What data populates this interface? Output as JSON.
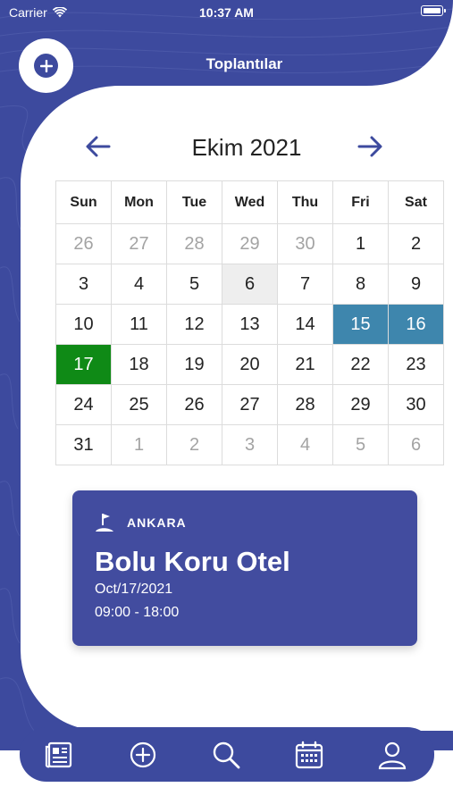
{
  "status": {
    "carrier": "Carrier",
    "time": "10:37 AM"
  },
  "header": {
    "title": "Toplantılar"
  },
  "calendar": {
    "month_label": "Ekim 2021",
    "weekdays": [
      "Sun",
      "Mon",
      "Tue",
      "Wed",
      "Thu",
      "Fri",
      "Sat"
    ],
    "weeks": [
      [
        "26",
        "27",
        "28",
        "29",
        "30",
        "1",
        "2"
      ],
      [
        "3",
        "4",
        "5",
        "6",
        "7",
        "8",
        "9"
      ],
      [
        "10",
        "11",
        "12",
        "13",
        "14",
        "15",
        "16"
      ],
      [
        "17",
        "18",
        "19",
        "20",
        "21",
        "22",
        "23"
      ],
      [
        "24",
        "25",
        "26",
        "27",
        "28",
        "29",
        "30"
      ],
      [
        "31",
        "1",
        "2",
        "3",
        "4",
        "5",
        "6"
      ]
    ],
    "muted": [
      [
        0,
        0
      ],
      [
        0,
        1
      ],
      [
        0,
        2
      ],
      [
        0,
        3
      ],
      [
        0,
        4
      ],
      [
        5,
        1
      ],
      [
        5,
        2
      ],
      [
        5,
        3
      ],
      [
        5,
        4
      ],
      [
        5,
        5
      ],
      [
        5,
        6
      ]
    ],
    "today": [
      1,
      3
    ],
    "highlight_blue": [
      [
        2,
        5
      ],
      [
        2,
        6
      ]
    ],
    "highlight_green": [
      [
        3,
        0
      ]
    ],
    "colors": {
      "blue": "#3e86ad",
      "green": "#0f8a16",
      "primary": "#3d4a9e"
    }
  },
  "event": {
    "city": "ANKARA",
    "title": "Bolu Koru Otel",
    "date": "Oct/17/2021",
    "time": "09:00 - 18:00",
    "icon": "golf-flag-icon"
  },
  "tabbar": {
    "items": [
      {
        "icon": "newspaper-icon"
      },
      {
        "icon": "plus-circle-icon"
      },
      {
        "icon": "search-icon"
      },
      {
        "icon": "calendar-icon"
      },
      {
        "icon": "user-icon"
      }
    ]
  }
}
